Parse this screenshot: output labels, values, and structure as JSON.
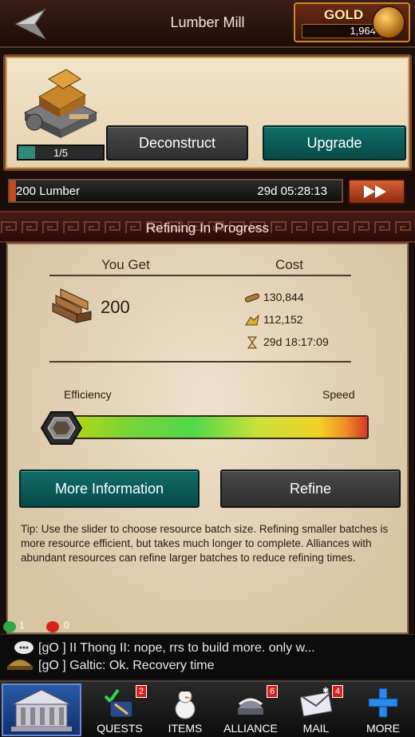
{
  "header": {
    "title": "Lumber Mill",
    "gold_label": "GOLD",
    "gold_value": "1,964"
  },
  "building": {
    "level_text": "1/5",
    "level_progress": 0.2,
    "deconstruct_label": "Deconstruct",
    "upgrade_label": "Upgrade"
  },
  "progress": {
    "label": "200 Lumber",
    "time": "29d 05:28:13",
    "fill_fraction": 0.02
  },
  "section": {
    "title": "Refining In Progress"
  },
  "refine": {
    "you_get_label": "You Get",
    "cost_label": "Cost",
    "amount": "200",
    "costs": [
      {
        "icon": "wood-icon",
        "value": "130,844"
      },
      {
        "icon": "ore-icon",
        "value": "112,152"
      },
      {
        "icon": "hourglass-icon",
        "value": "29d 18:17:09"
      }
    ],
    "efficiency_label": "Efficiency",
    "speed_label": "Speed",
    "slider_value": 0,
    "more_info_label": "More Information",
    "refine_label": "Refine",
    "tip": "Tip: Use the slider to choose resource batch size. Refining smaller batches is more resource efficient, but takes much longer to complete. Alliances with abundant resources can refine larger batches to reduce refining times."
  },
  "status": {
    "online": "1",
    "messages": "0"
  },
  "chat": {
    "lines": [
      "[gO ] II Thong II: nope,  rrs to build more.  only w...",
      "[gO ] Galtic: Ok. Recovery time"
    ]
  },
  "nav": {
    "items": [
      {
        "label": "QUESTS",
        "badge": "2"
      },
      {
        "label": "ITEMS",
        "badge": ""
      },
      {
        "label": "ALLIANCE",
        "badge": "6"
      },
      {
        "label": "MAIL",
        "badge": "4"
      },
      {
        "label": "MORE",
        "badge": ""
      }
    ]
  },
  "colors": {
    "teal_button": "#0f6e6a",
    "gray_button": "#3a3a3a",
    "gold_border": "#c98b2c",
    "progress_fill": "#c84a1c",
    "badge_red": "#d8221a"
  }
}
